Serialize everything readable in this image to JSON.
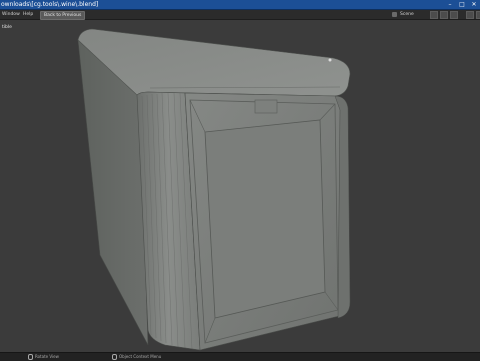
{
  "window": {
    "title": "ownloads\\[cg.tools\\.wine\\.blend]",
    "controls": [
      "–",
      "□",
      "✕"
    ]
  },
  "menu": {
    "items": [
      "Window",
      "Help"
    ],
    "back_button": "Back to Previous",
    "scene_label": "Scene"
  },
  "viewport": {
    "label": "tible",
    "colors": {
      "background": "#3b3b3b",
      "accent": "#1c4f96"
    }
  },
  "status": {
    "rotate": "Rotate View",
    "context": "Object Context Menu"
  },
  "icons": [
    "window-minimize-icon",
    "window-maximize-icon",
    "window-close-icon",
    "scene-icon",
    "mouse-icon"
  ]
}
